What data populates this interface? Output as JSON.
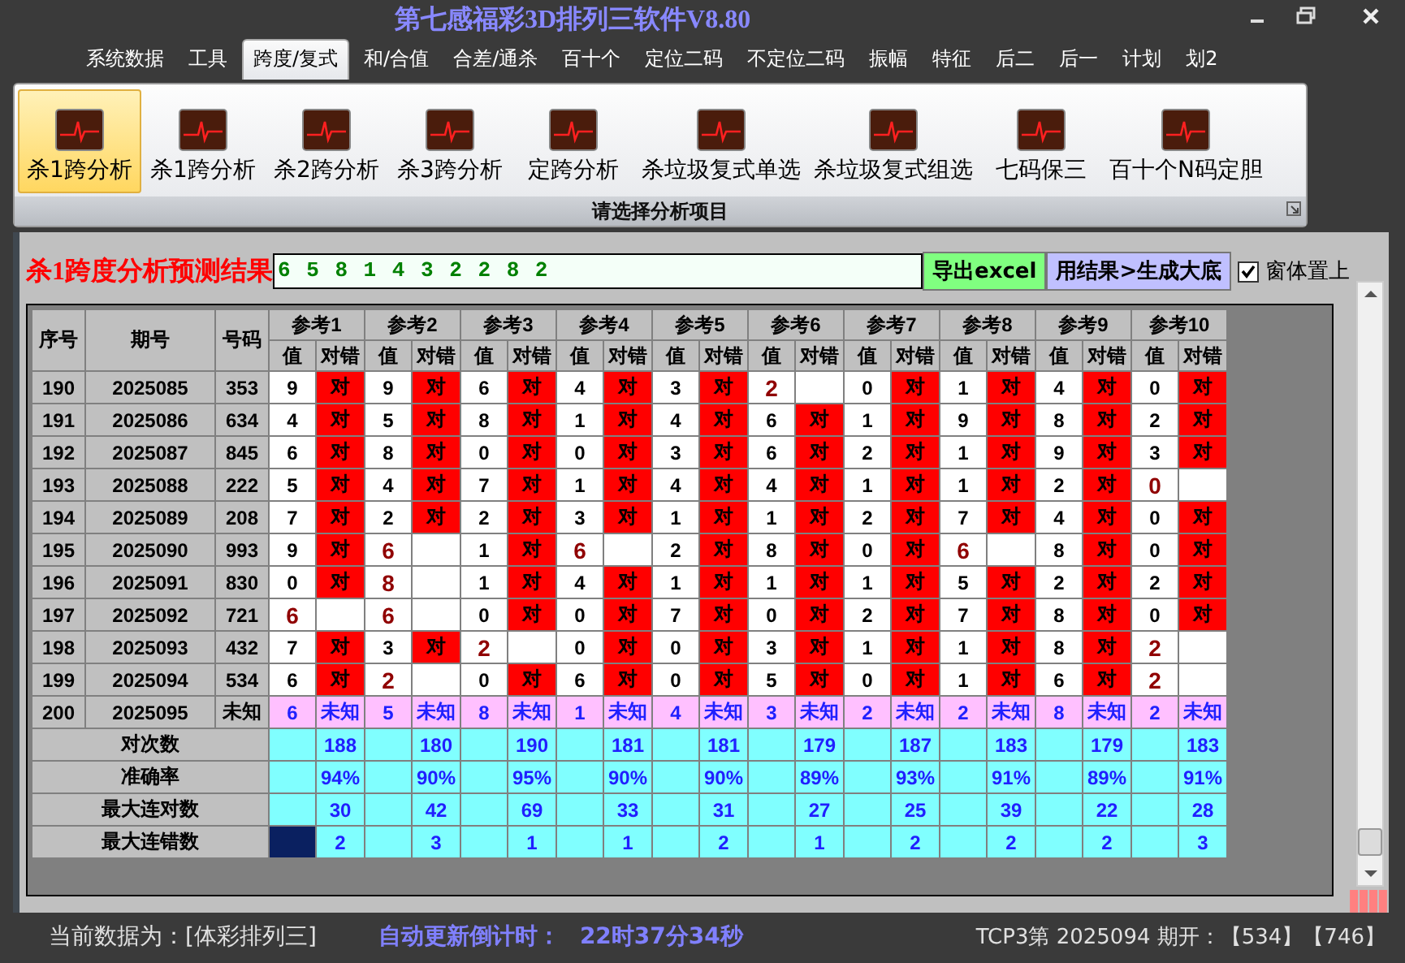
{
  "window": {
    "title": "第七感福彩3D排列三软件V8.80"
  },
  "menu_tabs": [
    {
      "label": "系统数据",
      "selected": false
    },
    {
      "label": "工具",
      "selected": false
    },
    {
      "label": "跨度/复式",
      "selected": true
    },
    {
      "label": "和/合值",
      "selected": false
    },
    {
      "label": "合差/通杀",
      "selected": false
    },
    {
      "label": "百十个",
      "selected": false
    },
    {
      "label": "定位二码",
      "selected": false
    },
    {
      "label": "不定位二码",
      "selected": false
    },
    {
      "label": "振幅",
      "selected": false
    },
    {
      "label": "特征",
      "selected": false
    },
    {
      "label": "后二",
      "selected": false
    },
    {
      "label": "后一",
      "selected": false
    },
    {
      "label": "计划",
      "selected": false
    },
    {
      "label": "划2",
      "selected": false
    }
  ],
  "ribbon": {
    "items": [
      {
        "label": "杀1跨分析",
        "selected": true
      },
      {
        "label": "杀1跨分析",
        "selected": false
      },
      {
        "label": "杀2跨分析",
        "selected": false
      },
      {
        "label": "杀3跨分析",
        "selected": false
      },
      {
        "label": "定跨分析",
        "selected": false
      },
      {
        "label": "杀垃圾复式单选",
        "selected": false
      },
      {
        "label": "杀垃圾复式组选",
        "selected": false
      },
      {
        "label": "七码保三",
        "selected": false
      },
      {
        "label": "百十个N码定胆",
        "selected": false
      }
    ],
    "caption": "请选择分析项目"
  },
  "result": {
    "label": "杀1跨度分析预测结果",
    "value": "6 5 8 1 4 3 2 2 8 2",
    "buttons": [
      {
        "label": "导出excel",
        "kind": "export"
      },
      {
        "label": "用结果>生成大底",
        "kind": "generate"
      }
    ],
    "pin_checkbox": {
      "label": "窗体置上",
      "checked": true
    }
  },
  "table": {
    "columns": [
      "序号",
      "期号",
      "号码"
    ],
    "ref_groups": [
      {
        "label": "参考1",
        "value_header": "值",
        "result_header": "对错"
      },
      {
        "label": "参考2",
        "value_header": "值",
        "result_header": "对错"
      },
      {
        "label": "参考3",
        "value_header": "值",
        "result_header": "对错"
      },
      {
        "label": "参考4",
        "value_header": "值",
        "result_header": "对错"
      },
      {
        "label": "参考5",
        "value_header": "值",
        "result_header": "对错"
      },
      {
        "label": "参考6",
        "value_header": "值",
        "result_header": "对错"
      },
      {
        "label": "参考7",
        "value_header": "值",
        "result_header": "对错"
      },
      {
        "label": "参考8",
        "value_header": "值",
        "result_header": "对错"
      },
      {
        "label": "参考9",
        "value_header": "值",
        "result_header": "对错"
      },
      {
        "label": "参考10",
        "value_header": "值",
        "result_header": "对错"
      }
    ],
    "rows": [
      {
        "kind": "history",
        "index": "190",
        "issue": "2025085",
        "number": "353",
        "refs": [
          {
            "value": "9",
            "hit": true,
            "mark": "对"
          },
          {
            "value": "9",
            "hit": true,
            "mark": "对"
          },
          {
            "value": "6",
            "hit": true,
            "mark": "对"
          },
          {
            "value": "4",
            "hit": true,
            "mark": "对"
          },
          {
            "value": "3",
            "hit": true,
            "mark": "对"
          },
          {
            "value": "2",
            "hit": false
          },
          {
            "value": "0",
            "hit": true,
            "mark": "对"
          },
          {
            "value": "1",
            "hit": true,
            "mark": "对"
          },
          {
            "value": "4",
            "hit": true,
            "mark": "对"
          },
          {
            "value": "0",
            "hit": true,
            "mark": "对"
          }
        ]
      },
      {
        "kind": "history",
        "index": "191",
        "issue": "2025086",
        "number": "634",
        "refs": [
          {
            "value": "4",
            "hit": true,
            "mark": "对"
          },
          {
            "value": "5",
            "hit": true,
            "mark": "对"
          },
          {
            "value": "8",
            "hit": true,
            "mark": "对"
          },
          {
            "value": "1",
            "hit": true,
            "mark": "对"
          },
          {
            "value": "4",
            "hit": true,
            "mark": "对"
          },
          {
            "value": "6",
            "hit": true,
            "mark": "对"
          },
          {
            "value": "1",
            "hit": true,
            "mark": "对"
          },
          {
            "value": "9",
            "hit": true,
            "mark": "对"
          },
          {
            "value": "8",
            "hit": true,
            "mark": "对"
          },
          {
            "value": "2",
            "hit": true,
            "mark": "对"
          }
        ]
      },
      {
        "kind": "history",
        "index": "192",
        "issue": "2025087",
        "number": "845",
        "refs": [
          {
            "value": "6",
            "hit": true,
            "mark": "对"
          },
          {
            "value": "8",
            "hit": true,
            "mark": "对"
          },
          {
            "value": "0",
            "hit": true,
            "mark": "对"
          },
          {
            "value": "0",
            "hit": true,
            "mark": "对"
          },
          {
            "value": "3",
            "hit": true,
            "mark": "对"
          },
          {
            "value": "6",
            "hit": true,
            "mark": "对"
          },
          {
            "value": "2",
            "hit": true,
            "mark": "对"
          },
          {
            "value": "1",
            "hit": true,
            "mark": "对"
          },
          {
            "value": "9",
            "hit": true,
            "mark": "对"
          },
          {
            "value": "3",
            "hit": true,
            "mark": "对"
          }
        ]
      },
      {
        "kind": "history",
        "index": "193",
        "issue": "2025088",
        "number": "222",
        "refs": [
          {
            "value": "5",
            "hit": true,
            "mark": "对"
          },
          {
            "value": "4",
            "hit": true,
            "mark": "对"
          },
          {
            "value": "7",
            "hit": true,
            "mark": "对"
          },
          {
            "value": "1",
            "hit": true,
            "mark": "对"
          },
          {
            "value": "4",
            "hit": true,
            "mark": "对"
          },
          {
            "value": "4",
            "hit": true,
            "mark": "对"
          },
          {
            "value": "1",
            "hit": true,
            "mark": "对"
          },
          {
            "value": "1",
            "hit": true,
            "mark": "对"
          },
          {
            "value": "2",
            "hit": true,
            "mark": "对"
          },
          {
            "value": "0",
            "hit": false
          }
        ]
      },
      {
        "kind": "history",
        "index": "194",
        "issue": "2025089",
        "number": "208",
        "refs": [
          {
            "value": "7",
            "hit": true,
            "mark": "对"
          },
          {
            "value": "2",
            "hit": true,
            "mark": "对"
          },
          {
            "value": "2",
            "hit": true,
            "mark": "对"
          },
          {
            "value": "3",
            "hit": true,
            "mark": "对"
          },
          {
            "value": "1",
            "hit": true,
            "mark": "对"
          },
          {
            "value": "1",
            "hit": true,
            "mark": "对"
          },
          {
            "value": "2",
            "hit": true,
            "mark": "对"
          },
          {
            "value": "7",
            "hit": true,
            "mark": "对"
          },
          {
            "value": "4",
            "hit": true,
            "mark": "对"
          },
          {
            "value": "0",
            "hit": true,
            "mark": "对"
          }
        ]
      },
      {
        "kind": "history",
        "index": "195",
        "issue": "2025090",
        "number": "993",
        "refs": [
          {
            "value": "9",
            "hit": true,
            "mark": "对"
          },
          {
            "value": "6",
            "hit": false
          },
          {
            "value": "1",
            "hit": true,
            "mark": "对"
          },
          {
            "value": "6",
            "hit": false
          },
          {
            "value": "2",
            "hit": true,
            "mark": "对"
          },
          {
            "value": "8",
            "hit": true,
            "mark": "对"
          },
          {
            "value": "0",
            "hit": true,
            "mark": "对"
          },
          {
            "value": "6",
            "hit": false
          },
          {
            "value": "8",
            "hit": true,
            "mark": "对"
          },
          {
            "value": "0",
            "hit": true,
            "mark": "对"
          }
        ]
      },
      {
        "kind": "history",
        "index": "196",
        "issue": "2025091",
        "number": "830",
        "refs": [
          {
            "value": "0",
            "hit": true,
            "mark": "对"
          },
          {
            "value": "8",
            "hit": false
          },
          {
            "value": "1",
            "hit": true,
            "mark": "对"
          },
          {
            "value": "4",
            "hit": true,
            "mark": "对"
          },
          {
            "value": "1",
            "hit": true,
            "mark": "对"
          },
          {
            "value": "1",
            "hit": true,
            "mark": "对"
          },
          {
            "value": "1",
            "hit": true,
            "mark": "对"
          },
          {
            "value": "5",
            "hit": true,
            "mark": "对"
          },
          {
            "value": "2",
            "hit": true,
            "mark": "对"
          },
          {
            "value": "2",
            "hit": true,
            "mark": "对"
          }
        ]
      },
      {
        "kind": "history",
        "index": "197",
        "issue": "2025092",
        "number": "721",
        "refs": [
          {
            "value": "6",
            "hit": false
          },
          {
            "value": "6",
            "hit": false
          },
          {
            "value": "0",
            "hit": true,
            "mark": "对"
          },
          {
            "value": "0",
            "hit": true,
            "mark": "对"
          },
          {
            "value": "7",
            "hit": true,
            "mark": "对"
          },
          {
            "value": "0",
            "hit": true,
            "mark": "对"
          },
          {
            "value": "2",
            "hit": true,
            "mark": "对"
          },
          {
            "value": "7",
            "hit": true,
            "mark": "对"
          },
          {
            "value": "8",
            "hit": true,
            "mark": "对"
          },
          {
            "value": "0",
            "hit": true,
            "mark": "对"
          }
        ]
      },
      {
        "kind": "history",
        "index": "198",
        "issue": "2025093",
        "number": "432",
        "refs": [
          {
            "value": "7",
            "hit": true,
            "mark": "对"
          },
          {
            "value": "3",
            "hit": true,
            "mark": "对"
          },
          {
            "value": "2",
            "hit": false
          },
          {
            "value": "0",
            "hit": true,
            "mark": "对"
          },
          {
            "value": "0",
            "hit": true,
            "mark": "对"
          },
          {
            "value": "3",
            "hit": true,
            "mark": "对"
          },
          {
            "value": "1",
            "hit": true,
            "mark": "对"
          },
          {
            "value": "1",
            "hit": true,
            "mark": "对"
          },
          {
            "value": "8",
            "hit": true,
            "mark": "对"
          },
          {
            "value": "2",
            "hit": false
          }
        ]
      },
      {
        "kind": "history",
        "index": "199",
        "issue": "2025094",
        "number": "534",
        "refs": [
          {
            "value": "6",
            "hit": true,
            "mark": "对"
          },
          {
            "value": "2",
            "hit": false
          },
          {
            "value": "0",
            "hit": true,
            "mark": "对"
          },
          {
            "value": "6",
            "hit": true,
            "mark": "对"
          },
          {
            "value": "0",
            "hit": true,
            "mark": "对"
          },
          {
            "value": "5",
            "hit": true,
            "mark": "对"
          },
          {
            "value": "0",
            "hit": true,
            "mark": "对"
          },
          {
            "value": "1",
            "hit": true,
            "mark": "对"
          },
          {
            "value": "6",
            "hit": true,
            "mark": "对"
          },
          {
            "value": "2",
            "hit": false
          }
        ]
      },
      {
        "kind": "pending",
        "index": "200",
        "issue": "2025095",
        "number": "未知",
        "refs": [
          {
            "value": "6",
            "mark": "未知"
          },
          {
            "value": "5",
            "mark": "未知"
          },
          {
            "value": "8",
            "mark": "未知"
          },
          {
            "value": "1",
            "mark": "未知"
          },
          {
            "value": "4",
            "mark": "未知"
          },
          {
            "value": "3",
            "mark": "未知"
          },
          {
            "value": "2",
            "mark": "未知"
          },
          {
            "value": "2",
            "mark": "未知"
          },
          {
            "value": "8",
            "mark": "未知"
          },
          {
            "value": "2",
            "mark": "未知"
          }
        ]
      }
    ],
    "stats": [
      {
        "label": "对次数",
        "selected": false,
        "values": [
          "188",
          "180",
          "190",
          "181",
          "181",
          "179",
          "187",
          "183",
          "179",
          "183"
        ]
      },
      {
        "label": "准确率",
        "selected": false,
        "values": [
          "94%",
          "90%",
          "95%",
          "90%",
          "90%",
          "89%",
          "93%",
          "91%",
          "89%",
          "91%"
        ]
      },
      {
        "label": "最大连对数",
        "selected": false,
        "values": [
          "30",
          "42",
          "69",
          "33",
          "31",
          "27",
          "25",
          "39",
          "22",
          "28"
        ]
      },
      {
        "label": "最大连错数",
        "selected": true,
        "values": [
          "2",
          "3",
          "1",
          "1",
          "2",
          "1",
          "2",
          "2",
          "2",
          "3"
        ]
      }
    ]
  },
  "status_bar": {
    "data_source": "当前数据为：[体彩排列三]",
    "countdown_label": "自动更新倒计时：",
    "countdown": "22时37分34秒",
    "last_draw": "TCP3第 2025094 期开：【534】【746】"
  }
}
